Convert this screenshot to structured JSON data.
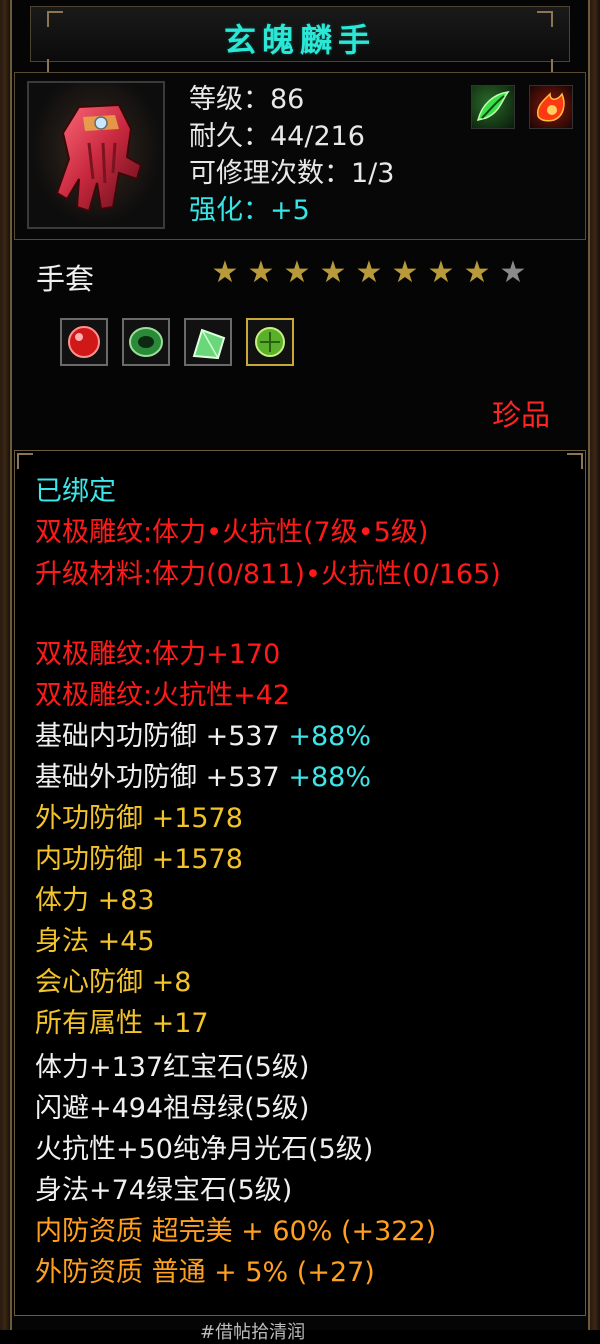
{
  "title": "玄魄麟手",
  "item": {
    "level_label": "等级：86",
    "durability_label": "耐久：44/216",
    "repair_label": "可修理次数：1/3",
    "enhance_label": "强化：+5",
    "type": "手套",
    "rarity": "珍品",
    "stars": {
      "filled": 8,
      "total": 9
    }
  },
  "colors": {
    "title": "#2ce6d6",
    "cyan": "#3ee6e8",
    "red": "#ff1a1a",
    "yellow": "#f2c32a",
    "orange": "#ffa020",
    "star_filled": "#b89a3a",
    "star_empty": "#8a8a8a"
  },
  "skill_icons": [
    "green-leaf-skill-icon",
    "red-flame-skill-icon"
  ],
  "gem_slots": [
    "ruby-gem-icon",
    "emerald-ring-gem-icon",
    "moonstone-gem-icon",
    "green-gem-icon"
  ],
  "details": {
    "bound": "已绑定",
    "carving1": "双极雕纹:体力•火抗性(7级•5级)",
    "upgrade_material": "升级材料:体力(0/811)•火抗性(0/165)",
    "carving2": "双极雕纹:体力+170",
    "carving3": "双极雕纹:火抗性+42",
    "base_inner_def": "基础内功防御 +537",
    "base_inner_def_pct": "+88%",
    "base_outer_def": "基础外功防御 +537",
    "base_outer_def_pct": "+88%",
    "outer_def": "外功防御 +1578",
    "inner_def": "内功防御 +1578",
    "stamina": "体力 +83",
    "agility": "身法 +45",
    "crit_def": "会心防御 +8",
    "all_attr": "所有属性 +17",
    "gem1": "体力+137红宝石(5级)",
    "gem2": "闪避+494祖母绿(5级)",
    "gem3": "火抗性+50纯净月光石(5级)",
    "gem4": "身法+74绿宝石(5级)",
    "inner_quality": "内防资质 超完美 + 60% (+322)",
    "outer_quality": "外防资质 普通 + 5% (+27)"
  },
  "footer_hint": "#借帖拾清润"
}
